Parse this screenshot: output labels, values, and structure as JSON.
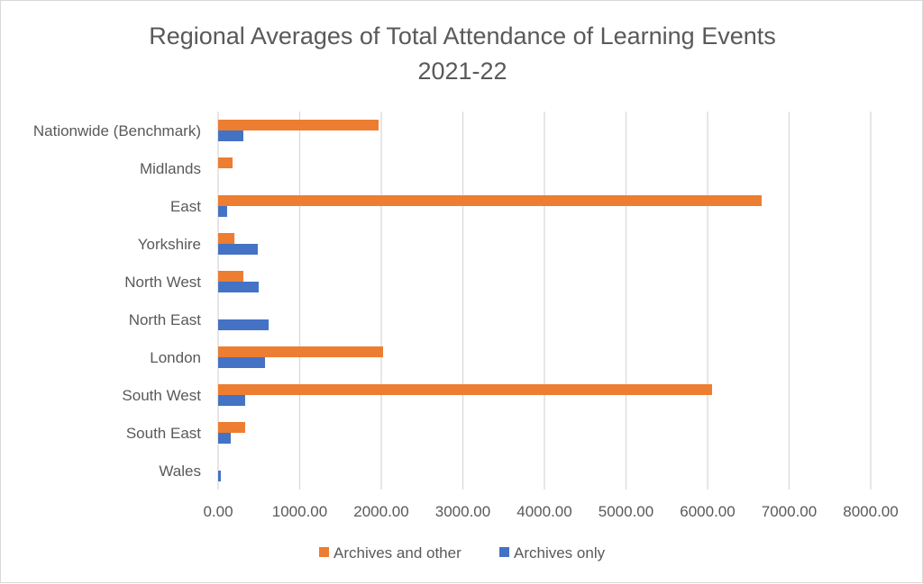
{
  "chart_data": {
    "type": "bar",
    "orientation": "horizontal",
    "title": "Regional Averages of Total Attendance of Learning Events",
    "subtitle": "2021-22",
    "xlabel": "",
    "ylabel": "",
    "xlim": [
      0,
      8000
    ],
    "x_ticks": [
      0,
      1000,
      2000,
      3000,
      4000,
      5000,
      6000,
      7000,
      8000
    ],
    "x_tick_labels": [
      "0.00",
      "1000.00",
      "2000.00",
      "3000.00",
      "4000.00",
      "5000.00",
      "6000.00",
      "7000.00",
      "8000.00"
    ],
    "grid": "vertical",
    "legend_position": "bottom",
    "categories": [
      "Nationwide (Benchmark)",
      "Midlands",
      "East",
      "Yorkshire",
      "North West",
      "North East",
      "London",
      "South West",
      "South East",
      "Wales"
    ],
    "series": [
      {
        "name": "Archives and other",
        "color": "#ED7D31",
        "values": [
          1967,
          177,
          6663,
          200,
          309,
          0,
          2022,
          6055,
          331,
          0
        ]
      },
      {
        "name": "Archives only",
        "color": "#4472C4",
        "values": [
          309,
          0,
          110,
          486,
          497,
          619,
          575,
          331,
          155,
          33
        ]
      }
    ]
  }
}
